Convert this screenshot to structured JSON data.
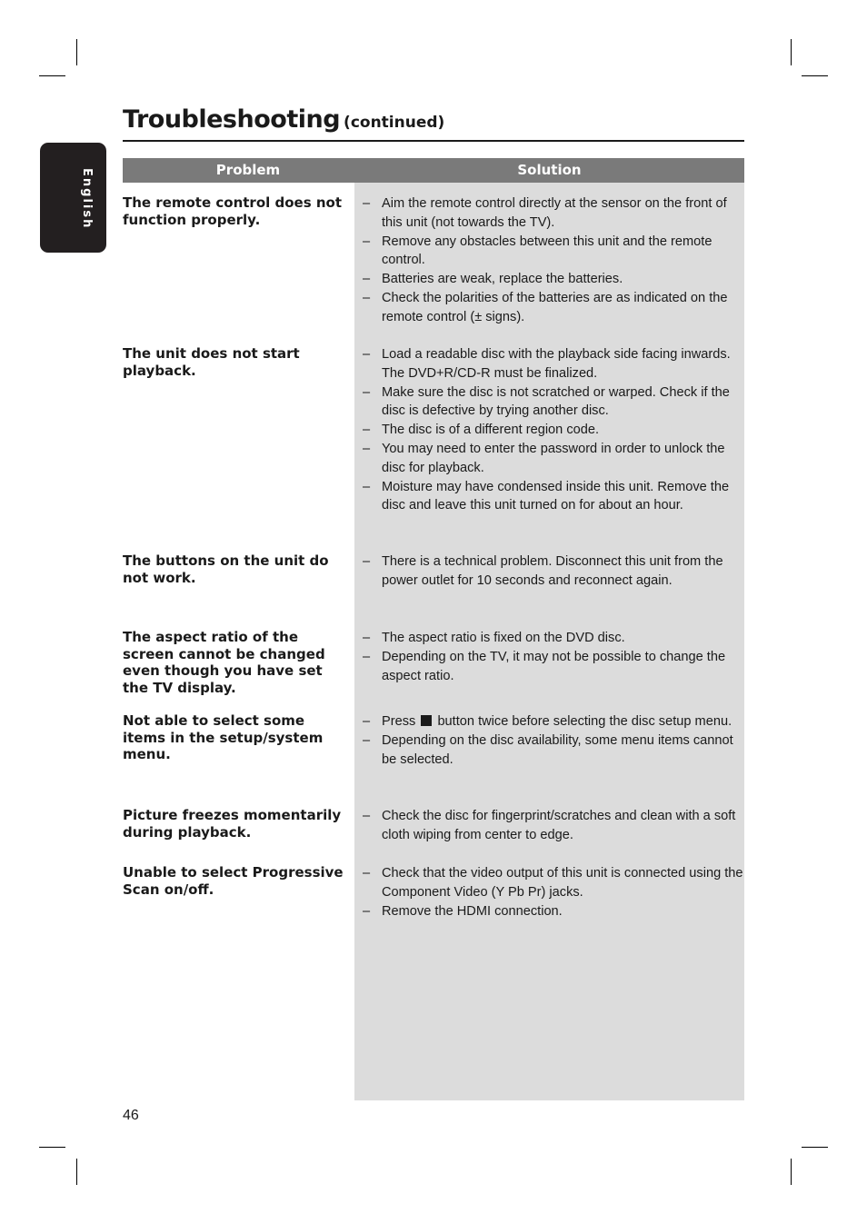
{
  "page": {
    "title": "Troubleshooting",
    "title_suffix": "(continued)",
    "language_tab": "English",
    "page_number": "46"
  },
  "table": {
    "headers": {
      "problem": "Problem",
      "solution": "Solution"
    },
    "rows": [
      {
        "problem": "The remote control does not function properly.",
        "solutions": [
          "Aim the remote control directly at the sensor on the front of this unit (not towards the TV).",
          "Remove any obstacles between this unit and the remote control.",
          "Batteries are weak, replace the batteries.",
          "Check the polarities of the batteries are as indicated on the remote control (± signs)."
        ]
      },
      {
        "problem": "The unit does not start playback.",
        "solutions": [
          "Load a readable disc with the playback side facing inwards. The DVD+R/CD-R must be finalized.",
          "Make sure the disc is not scratched or warped. Check if the disc is defective by trying another disc.",
          "The disc is of a different region code.",
          "You may need to enter the password in order to unlock the disc for playback.",
          "Moisture may have condensed inside this unit. Remove the disc and leave this unit turned on for about an hour."
        ]
      },
      {
        "problem": "The buttons on the unit do not work.",
        "solutions": [
          "There is a technical problem. Disconnect this unit from the power outlet for 10 seconds and reconnect again."
        ]
      },
      {
        "problem": "The aspect ratio of the screen cannot be changed even though you have set the TV display.",
        "solutions": [
          "The aspect ratio is fixed on the DVD disc.",
          "Depending on the TV, it may not be possible to change the aspect ratio."
        ]
      },
      {
        "problem": "Not able to select some items in the setup/system menu.",
        "solutions": [
          {
            "before": "Press",
            "icon": "stop-icon",
            "after": "button twice before selecting the disc setup menu."
          },
          "Depending on the disc availability, some menu items cannot be selected."
        ]
      },
      {
        "problem": "Picture freezes momentarily during playback.",
        "solutions": [
          "Check the disc for fingerprint/scratches and clean with a soft cloth wiping from center to edge."
        ]
      },
      {
        "problem": "Unable to select Progressive Scan on/off.",
        "solutions": [
          "Check that the video output of this unit is connected using the Component Video (Y Pb Pr) jacks.",
          "Remove the HDMI connection."
        ]
      }
    ]
  },
  "colors": {
    "header_bg": "#7a7a7a",
    "solution_bg": "#dcdcdc",
    "tab_bg": "#231f20",
    "text": "#1a1a1a"
  }
}
